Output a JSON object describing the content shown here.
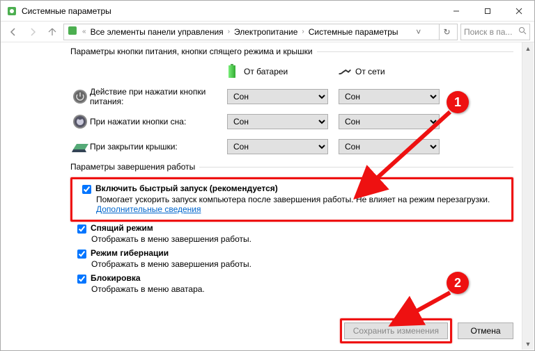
{
  "window": {
    "title": "Системные параметры"
  },
  "breadcrumb": {
    "all": "Все элементы панели управления",
    "power": "Электропитание",
    "sys": "Системные параметры"
  },
  "search": {
    "placeholder": "Поиск в па..."
  },
  "group1": {
    "title": "Параметры кнопки питания, кнопки спящего режима и крышки"
  },
  "cols": {
    "battery": "От батареи",
    "ac": "От сети"
  },
  "rows": {
    "power": {
      "label": "Действие при нажатии кнопки питания:",
      "battery": "Сон",
      "ac": "Сон"
    },
    "sleep": {
      "label": "При нажатии кнопки сна:",
      "battery": "Сон",
      "ac": "Сон"
    },
    "lid": {
      "label": "При закрытии крышки:",
      "battery": "Сон",
      "ac": "Сон"
    }
  },
  "group2": {
    "title": "Параметры завершения работы"
  },
  "fastboot": {
    "label": "Включить быстрый запуск (рекомендуется)",
    "desc1": "Помогает ускорить запуск компьютера после завершения работы. Не влияет на режим перезагрузки. ",
    "link": "Дополнительные сведения"
  },
  "sleepopt": {
    "label": "Спящий режим",
    "desc": "Отображать в меню завершения работы."
  },
  "hiber": {
    "label": "Режим гибернации",
    "desc": "Отображать в меню завершения работы."
  },
  "lock": {
    "label": "Блокировка",
    "desc": "Отображать в меню аватара."
  },
  "buttons": {
    "save": "Сохранить изменения",
    "cancel": "Отмена"
  },
  "callouts": {
    "one": "1",
    "two": "2"
  }
}
